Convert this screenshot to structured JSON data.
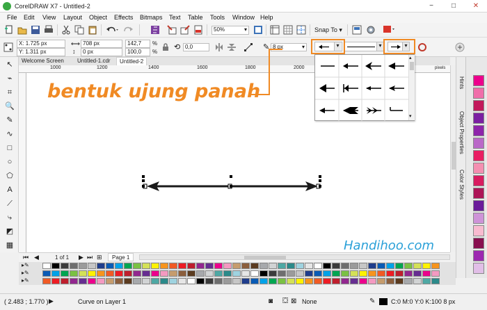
{
  "window": {
    "title": "CorelDRAW X7 - Untitled-2",
    "minimize": "−",
    "maximize": "□",
    "close": "✕"
  },
  "menu": [
    "File",
    "Edit",
    "View",
    "Layout",
    "Object",
    "Effects",
    "Bitmaps",
    "Text",
    "Table",
    "Tools",
    "Window",
    "Help"
  ],
  "toolbar": {
    "zoom": "50%",
    "snap_to": "Snap To"
  },
  "property_bar": {
    "x": "X: 1.725 px",
    "y": "Y: 1.311 px",
    "width": "708 px",
    "height": "0 px",
    "scale_w": "142,7",
    "scale_h": "100,0",
    "pct": "%",
    "angle": "0,0",
    "outline_width": "8 px"
  },
  "document_tabs": [
    "Welcome Screen",
    "Untitled-1.cdr",
    "Untitled-2"
  ],
  "active_tab": "Untitled-2",
  "ruler": {
    "ticks": [
      "1000",
      "1200",
      "1400",
      "1600",
      "1800",
      "2000",
      "2200",
      "2400"
    ],
    "unit": "pixels"
  },
  "annotation": {
    "text": "bentuk ujung panah",
    "color": "#f08a24"
  },
  "watermark": "Handihoo.com",
  "dockers": [
    "Hints",
    "Object Properties",
    "Color Styles"
  ],
  "page_nav": {
    "counter": "1 of 1",
    "page_tab": "Page 1"
  },
  "status": {
    "coords": "( 2.483 ; 1.770 )",
    "info": "Curve on Layer 1",
    "fill": "None",
    "outline": "C:0 M:0 Y:0 K:100  8 px"
  },
  "palette_colors": [
    "#ffffff",
    "#000000",
    "#3b3b3b",
    "#6e6e6e",
    "#9b9b9b",
    "#c6c6c6",
    "#1f3d8c",
    "#0a5bb5",
    "#00a2e8",
    "#00a651",
    "#7ac143",
    "#d4e157",
    "#fff200",
    "#f7941d",
    "#f15a24",
    "#ed1c24",
    "#be1e2d",
    "#92278f",
    "#662d91",
    "#ec008c",
    "#f49ac1",
    "#c69c6d",
    "#8b5e3c",
    "#5b3b1f",
    "#a7a9ac",
    "#d1d3d4",
    "#4ea8a4",
    "#2b8a8a",
    "#9fd3e0",
    "#e6e6e6"
  ],
  "vpalette_colors": [
    "#ec008c",
    "#f06eaa",
    "#c2185b",
    "#7b1fa2",
    "#8e24aa",
    "#ba68c8",
    "#e91e63",
    "#f48fb1",
    "#d81b60",
    "#ad1457",
    "#6a1b9a",
    "#ce93d8",
    "#f8bbd0",
    "#880e4f",
    "#9c27b0",
    "#e1bee7"
  ]
}
